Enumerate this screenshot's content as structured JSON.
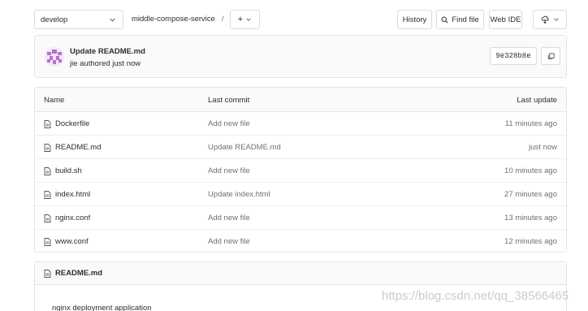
{
  "toolbar": {
    "branch": "develop",
    "project": "middle-compose-service",
    "separator": "/",
    "add_label": "+",
    "history_label": "History",
    "find_file_label": "Find file",
    "web_ide_label": "Web IDE"
  },
  "commit": {
    "title": "Update README.md",
    "meta": "jie authored just now",
    "sha": "9e328b8e"
  },
  "table": {
    "headers": {
      "name": "Name",
      "last_commit": "Last commit",
      "last_update": "Last update"
    },
    "rows": [
      {
        "name": "Dockerfile",
        "commit": "Add new file",
        "updated": "11 minutes ago"
      },
      {
        "name": "README.md",
        "commit": "Update README.md",
        "updated": "just now"
      },
      {
        "name": "build.sh",
        "commit": "Add new file",
        "updated": "10 minutes ago"
      },
      {
        "name": "index.html",
        "commit": "Update index.html",
        "updated": "27 minutes ago"
      },
      {
        "name": "nginx.conf",
        "commit": "Add new file",
        "updated": "13 minutes ago"
      },
      {
        "name": "www.conf",
        "commit": "Add new file",
        "updated": "12 minutes ago"
      }
    ]
  },
  "readme": {
    "title": "README.md",
    "body": "nginx deployment application"
  },
  "watermark": "https://blog.csdn.net/qq_38566465",
  "colors": {
    "border": "#e5e5e5",
    "text": "#2e2e2e",
    "muted": "#707070",
    "avatar": "#b86fd0"
  }
}
